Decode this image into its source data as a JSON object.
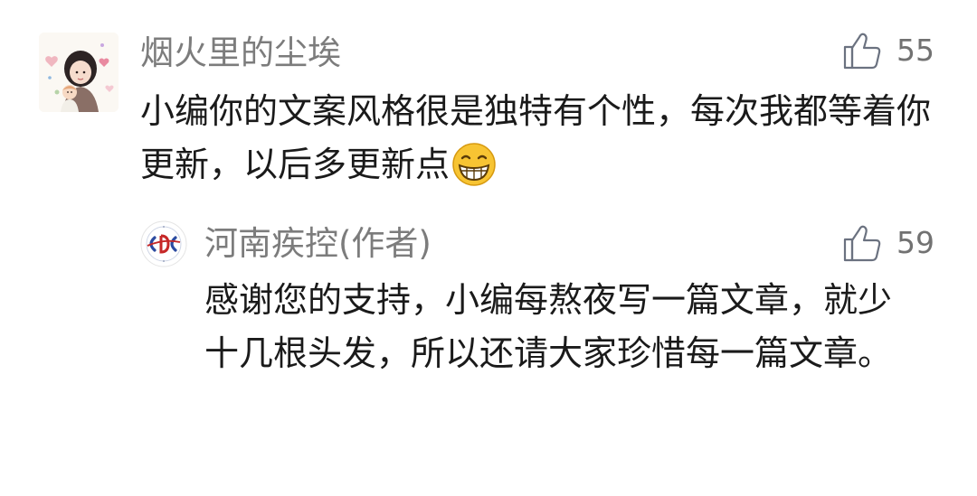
{
  "comments": [
    {
      "nickname": "烟火里的尘埃",
      "likes": "55",
      "text": "小编你的文案风格很是独特有个性，每次我都等着你更新，以后多更新点",
      "emoji": "grinning-face-emoji"
    }
  ],
  "reply": {
    "nickname": "河南疾控(作者)",
    "likes": "59",
    "text": "感谢您的支持，小编每熬夜写一篇文章，就少十几根头发，所以还请大家珍惜每一篇文章。"
  },
  "icons": {
    "like": "thumbs-up-icon",
    "author_logo": "cdc-logo"
  },
  "colors": {
    "nickname": "#7c7c7c",
    "text": "#1a1a1a",
    "like_icon": "#6b7280"
  }
}
